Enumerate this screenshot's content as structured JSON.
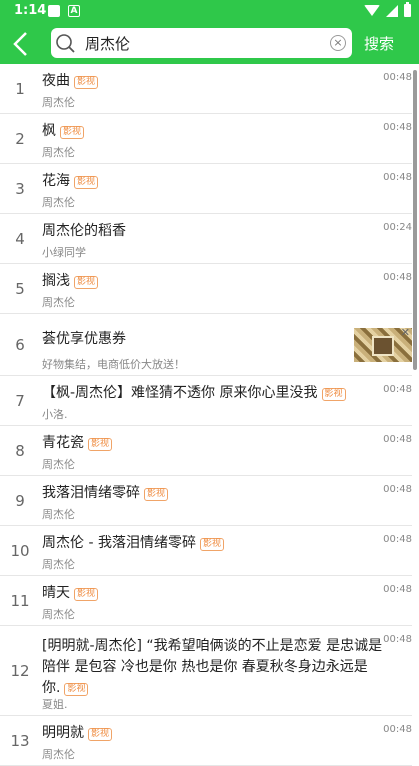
{
  "status_bar": {
    "time": "1:14",
    "notif_icon_a": "A"
  },
  "toolbar": {
    "query": "周杰伦",
    "search_label": "搜索",
    "clear_glyph": "×"
  },
  "badge_label": "影视",
  "results": [
    {
      "index": "1",
      "title": "夜曲",
      "badge": true,
      "subtitle": "周杰伦",
      "duration": "00:48"
    },
    {
      "index": "2",
      "title": "枫",
      "badge": true,
      "subtitle": "周杰伦",
      "duration": "00:48"
    },
    {
      "index": "3",
      "title": "花海",
      "badge": true,
      "subtitle": "周杰伦",
      "duration": "00:48"
    },
    {
      "index": "4",
      "title": "周杰伦的稻香",
      "badge": false,
      "subtitle": "小绿同学",
      "duration": "00:24"
    },
    {
      "index": "5",
      "title": "搁浅",
      "badge": true,
      "subtitle": "周杰伦",
      "duration": "00:48"
    },
    {
      "index": "6",
      "title": "荟优享优惠券",
      "badge": false,
      "subtitle": "好物集结，电商低价大放送！",
      "ad": true,
      "close": "✕"
    },
    {
      "index": "7",
      "title": "【枫-周杰伦】难怪猜不透你 原来你心里没我",
      "badge": true,
      "subtitle": "小洛.",
      "duration": "00:48"
    },
    {
      "index": "8",
      "title": "青花瓷",
      "badge": true,
      "subtitle": "周杰伦",
      "duration": "00:48"
    },
    {
      "index": "9",
      "title": "我落泪情绪零碎",
      "badge": true,
      "subtitle": "周杰伦",
      "duration": "00:48"
    },
    {
      "index": "10",
      "title": "周杰伦 - 我落泪情绪零碎",
      "badge": true,
      "subtitle": "周杰伦",
      "duration": "00:48"
    },
    {
      "index": "11",
      "title": "晴天",
      "badge": true,
      "subtitle": "周杰伦",
      "duration": "00:48"
    },
    {
      "index": "12",
      "title": " [明明就-周杰伦] “我希望咱俩谈的不止是恋爱 是忠诚是陪伴 是包容 冷也是你 热也是你 春夏秋冬身边永远是你.",
      "badge": true,
      "subtitle": "夏姐.",
      "duration": "00:48"
    },
    {
      "index": "13",
      "title": "明明就",
      "badge": true,
      "subtitle": "周杰伦",
      "duration": "00:48"
    }
  ]
}
